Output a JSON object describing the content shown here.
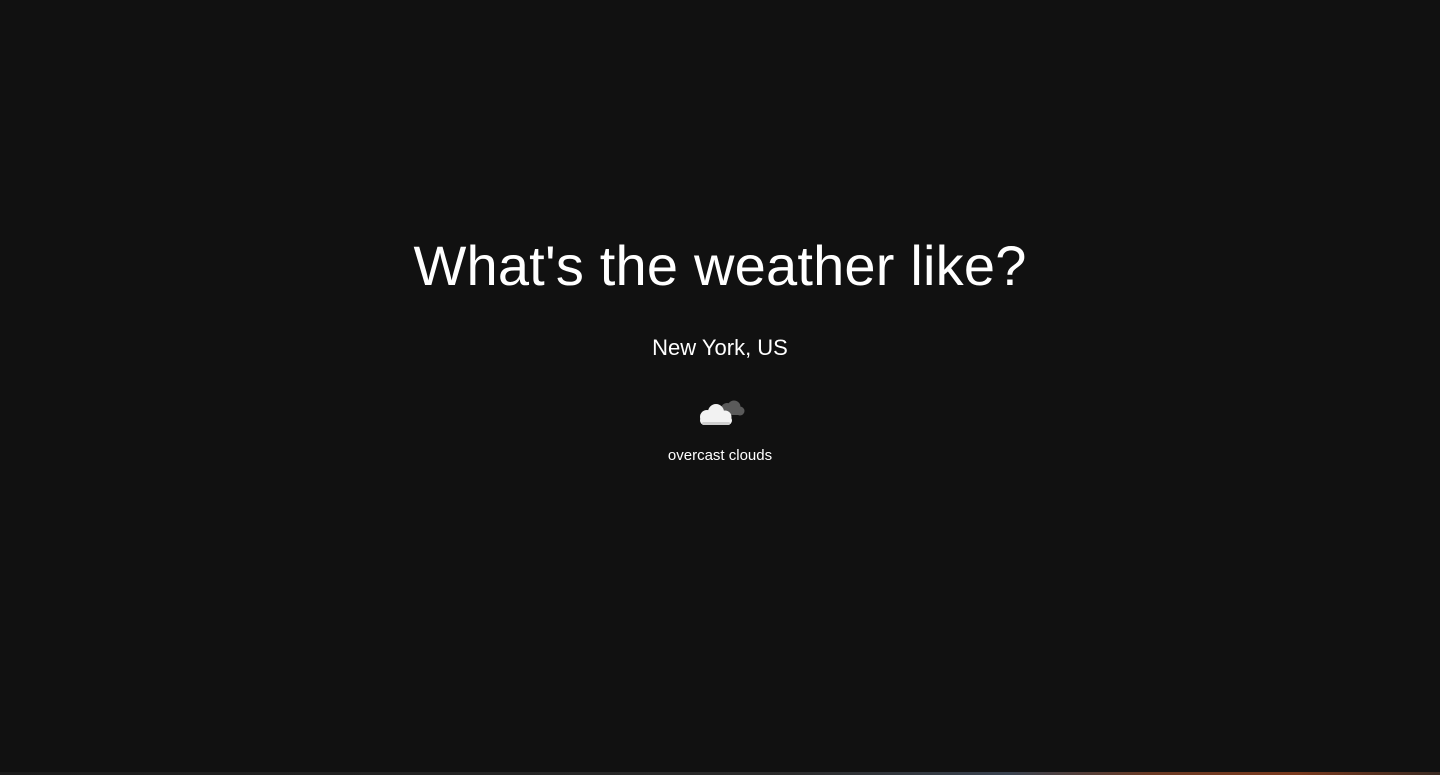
{
  "header": {
    "title": "What's the weather like?"
  },
  "weather": {
    "location": "New York, US",
    "icon": "overcast-clouds-icon",
    "description": "overcast clouds"
  },
  "colors": {
    "background": "#111111",
    "text": "#ffffff"
  }
}
